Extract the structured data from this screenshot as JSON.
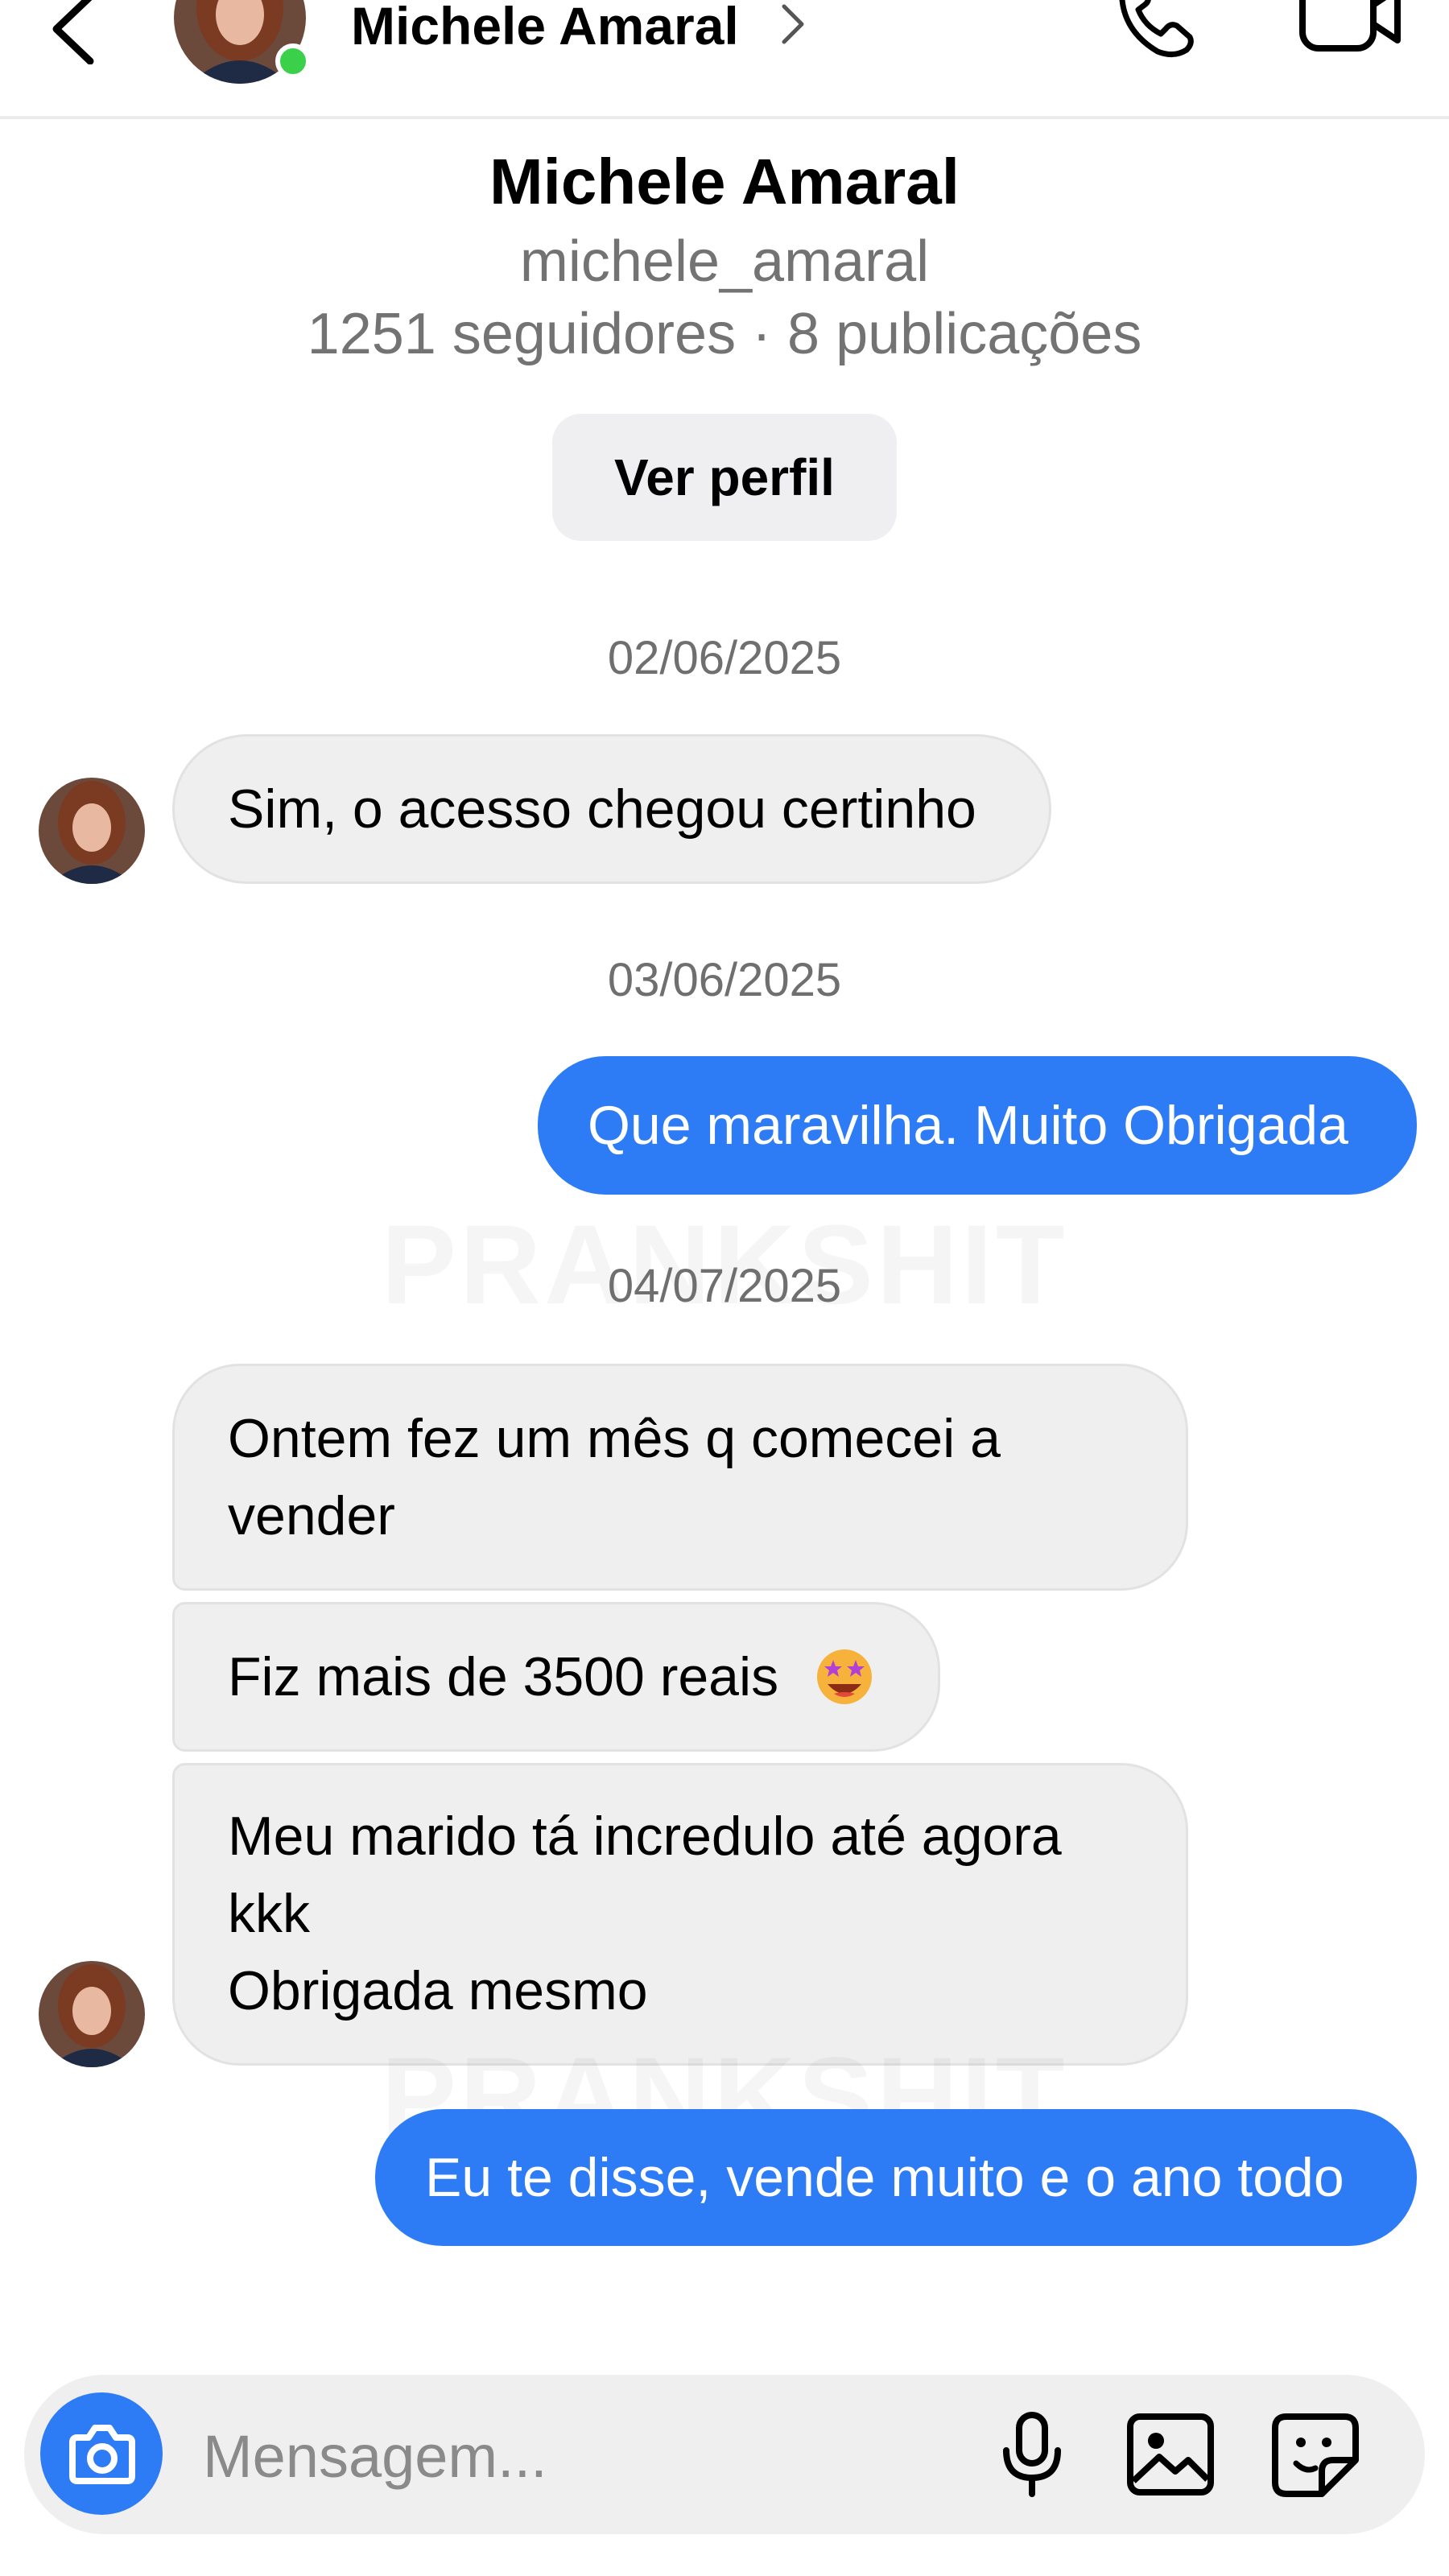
{
  "header": {
    "name": "Michele Amaral"
  },
  "profile": {
    "name": "Michele Amaral",
    "username": "michele_amaral",
    "stats": "1251 seguidores · 8 publicações",
    "view_profile_label": "Ver perfil"
  },
  "watermark": "PRANKSHIT",
  "dates": [
    "02/06/2025",
    "03/06/2025",
    "04/07/2025"
  ],
  "messages": {
    "m1": "Sim, o acesso chegou certinho",
    "m2": "Que maravilha. Muito Obrigada",
    "m3_line1": "Ontem fez um mês q comecei a",
    "m3_line2": "vender",
    "m4": "Fiz mais de 3500 reais",
    "m4_emoji": "star-struck-emoji",
    "m5_line1": "Meu marido tá incredulo até agora",
    "m5_line2": "kkk",
    "m5_line3": "Obrigada mesmo",
    "m6": "Eu te disse, vende muito e o ano todo"
  },
  "composer": {
    "placeholder": "Mensagem..."
  },
  "colors": {
    "accent": "#2d7cf6",
    "incoming_bubble": "#efefef",
    "online": "#3bd04a",
    "muted_text": "#737373"
  },
  "icons": {
    "back": "chevron-left-icon",
    "call": "phone-icon",
    "video": "video-camera-icon",
    "camera": "camera-icon",
    "mic": "microphone-icon",
    "image": "image-icon",
    "sticker": "sticker-icon"
  }
}
